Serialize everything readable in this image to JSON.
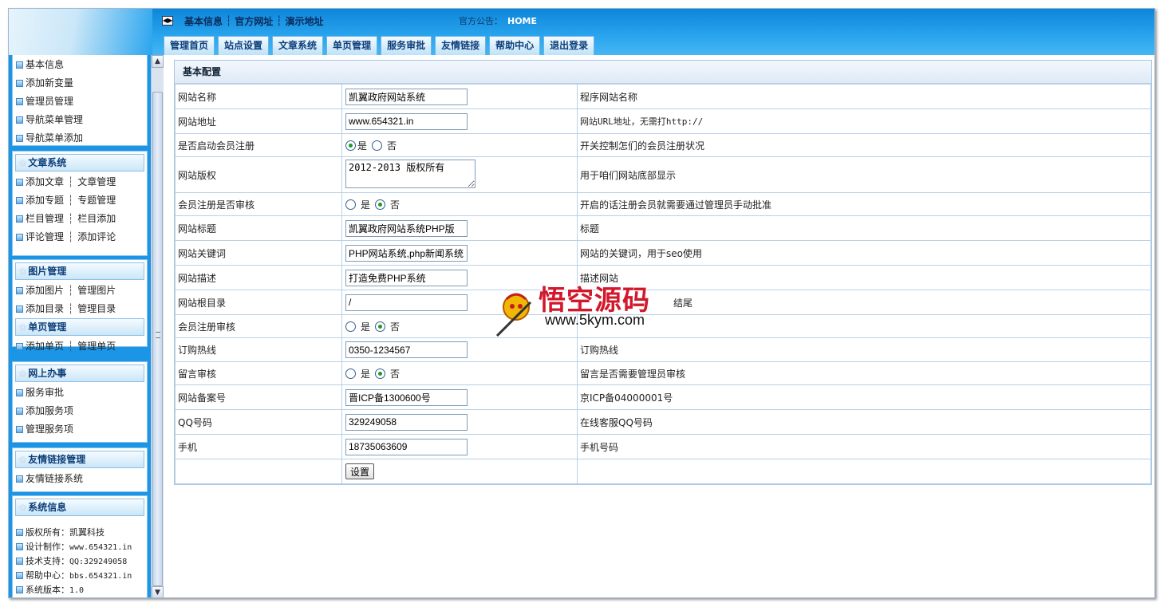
{
  "header": {
    "toplinks": [
      "基本信息",
      "官方网址",
      "演示地址"
    ],
    "notice_label": "官方公告：",
    "notice_value": "HOME",
    "tabs": [
      "管理首页",
      "站点设置",
      "文章系统",
      "单页管理",
      "服务审批",
      "友情链接",
      "帮助中心",
      "退出登录"
    ]
  },
  "sidebar": {
    "basic_items": [
      "基本信息",
      "添加新变量",
      "管理员管理",
      "导航菜单管理",
      "导航菜单添加"
    ],
    "article": {
      "title": "文章系统",
      "rows": [
        [
          "添加文章",
          "文章管理"
        ],
        [
          "添加专题",
          "专题管理"
        ],
        [
          "栏目管理",
          "栏目添加"
        ],
        [
          "评论管理",
          "添加评论"
        ]
      ]
    },
    "image": {
      "title": "图片管理",
      "rows": [
        [
          "添加图片",
          "管理图片"
        ],
        [
          "添加目录",
          "管理目录"
        ]
      ]
    },
    "page": {
      "title": "单页管理",
      "rows": [
        [
          "添加单页",
          "管理单页"
        ]
      ]
    },
    "online": {
      "title": "网上办事",
      "items": [
        "服务审批",
        "添加服务项",
        "管理服务项"
      ]
    },
    "links": {
      "title": "友情链接管理",
      "items": [
        "友情链接系统"
      ]
    },
    "sysinfo": {
      "title": "系统信息",
      "items": [
        {
          "label": "版权所有：",
          "value": "凯翼科技"
        },
        {
          "label": "设计制作：",
          "value": "www.654321.in"
        },
        {
          "label": "技术支持：",
          "value": "QQ:329249058"
        },
        {
          "label": "帮助中心：",
          "value": "bbs.654321.in"
        },
        {
          "label": "系统版本：",
          "value": "1.0"
        }
      ]
    }
  },
  "panel": {
    "title": "基本配置",
    "rows": [
      {
        "label": "网站名称",
        "value": "凯翼政府网站系统",
        "desc": "程序网站名称"
      },
      {
        "label": "网站地址",
        "value": "www.654321.in",
        "desc": "网站URL地址，无需打http://"
      },
      {
        "label": "是否启动会员注册",
        "options": [
          "是",
          "否"
        ],
        "selected": "是",
        "desc": "开关控制怎们的会员注册状况"
      },
      {
        "label": "网站版权",
        "value": "2012-2013 版权所有",
        "desc": "用于咱们网站底部显示"
      },
      {
        "label": "会员注册是否审核",
        "options": [
          "是",
          "否"
        ],
        "selected": "否",
        "desc": "开启的话注册会员就需要通过管理员手动批准"
      },
      {
        "label": "网站标题",
        "value": "凯翼政府网站系统PHP版",
        "desc": "标题"
      },
      {
        "label": "网站关键词",
        "value": "PHP网站系统,php新闻系统",
        "desc": "网站的关键词，用于seo使用"
      },
      {
        "label": "网站描述",
        "value": "打造免费PHP系统",
        "desc": "描述网站"
      },
      {
        "label": "网站根目录",
        "value": "/",
        "desc": "结尾"
      },
      {
        "label": "会员注册审核",
        "options": [
          "是",
          "否"
        ],
        "selected": "否",
        "desc": ""
      },
      {
        "label": "订购热线",
        "value": "0350-1234567",
        "desc": "订购热线"
      },
      {
        "label": "留言审核",
        "options": [
          "是",
          "否"
        ],
        "selected": "否",
        "desc": "留言是否需要管理员审核"
      },
      {
        "label": "网站备案号",
        "value": "晋ICP备1300600号",
        "desc": "京ICP备04000001号"
      },
      {
        "label": "QQ号码",
        "value": "329249058",
        "desc": "在线客服QQ号码"
      },
      {
        "label": "手机",
        "value": "18735063609",
        "desc": "手机号码"
      }
    ],
    "submit_label": "设置"
  },
  "watermark": {
    "title": "悟空源码",
    "url": "www.5kym.com"
  },
  "colors": {
    "header_blue": "#1b95e6",
    "tab_text": "#0e3f7a",
    "watermark_red": "#d2182b"
  }
}
